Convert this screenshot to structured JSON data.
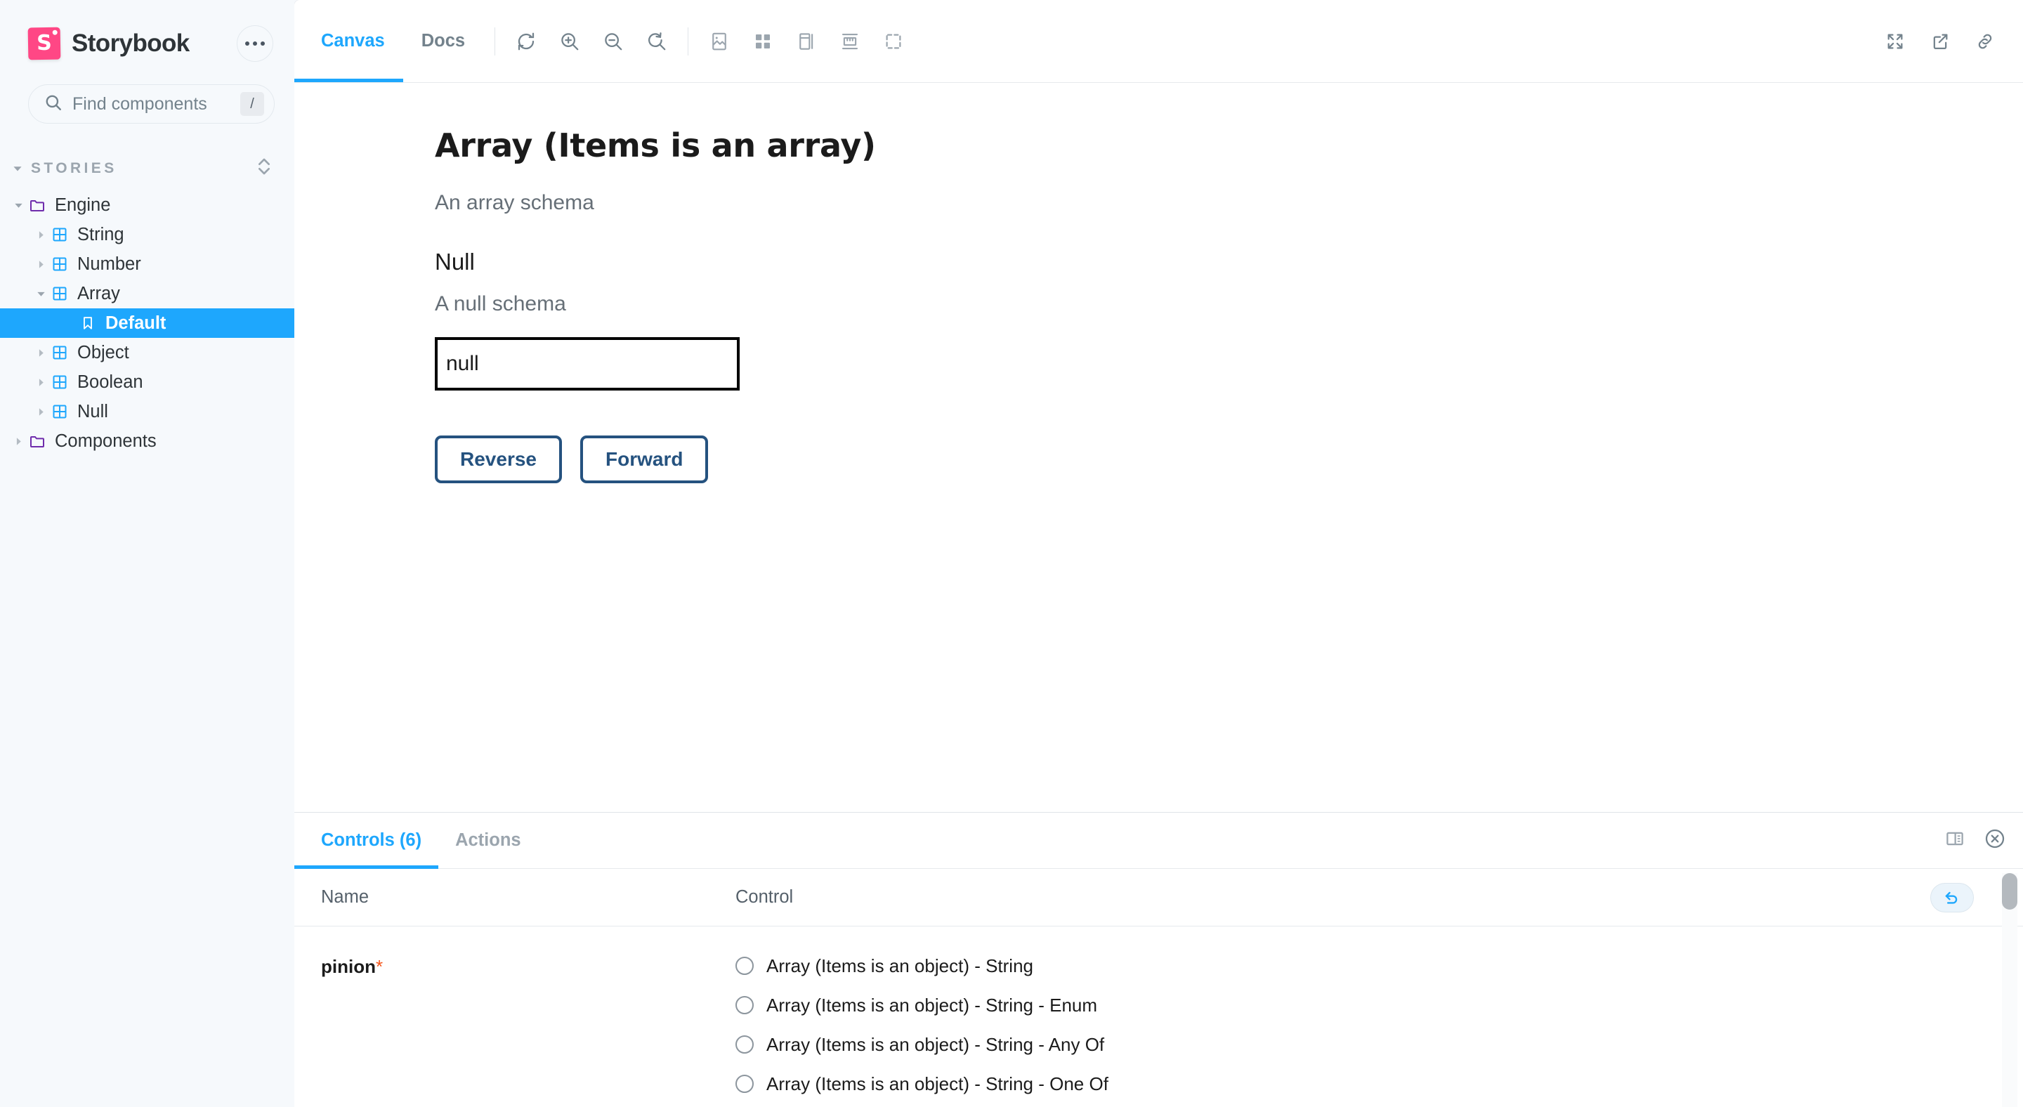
{
  "sidebar": {
    "brand": {
      "name": "Storybook",
      "logo_glyph": "S",
      "logo_color": "#FF4785"
    },
    "menu_button": "menu-dots",
    "search": {
      "placeholder": "Find components",
      "shortcut": "/"
    },
    "section": {
      "label": "STORIES"
    },
    "tree": [
      {
        "label": "Engine",
        "depth": 0,
        "icon": "folder",
        "caret": "down",
        "selected": false
      },
      {
        "label": "String",
        "depth": 1,
        "icon": "component",
        "caret": "right",
        "selected": false
      },
      {
        "label": "Number",
        "depth": 1,
        "icon": "component",
        "caret": "right",
        "selected": false
      },
      {
        "label": "Array",
        "depth": 1,
        "icon": "component",
        "caret": "down",
        "selected": false
      },
      {
        "label": "Default",
        "depth": 2,
        "icon": "bookmark",
        "caret": "none",
        "selected": true
      },
      {
        "label": "Object",
        "depth": 1,
        "icon": "component",
        "caret": "right",
        "selected": false
      },
      {
        "label": "Boolean",
        "depth": 1,
        "icon": "component",
        "caret": "right",
        "selected": false
      },
      {
        "label": "Null",
        "depth": 1,
        "icon": "component",
        "caret": "right",
        "selected": false
      },
      {
        "label": "Components",
        "depth": 0,
        "icon": "folder",
        "caret": "right",
        "selected": false
      }
    ]
  },
  "toolbar": {
    "tabs": [
      {
        "label": "Canvas",
        "active": true
      },
      {
        "label": "Docs",
        "active": false
      }
    ],
    "tools": [
      "refresh-icon",
      "zoom-in-icon",
      "zoom-out-icon",
      "zoom-reset-icon",
      "backgrounds-icon",
      "grid-icon",
      "outline-icon",
      "measure-icon",
      "viewport-icon"
    ],
    "right_tools": [
      "fullscreen-icon",
      "open-new-tab-icon",
      "copy-link-icon"
    ]
  },
  "story": {
    "title": "Array (Items is an array)",
    "description": "An array schema",
    "subtitle": "Null",
    "sub_description": "A null schema",
    "input_value": "null",
    "buttons": [
      {
        "label": "Reverse"
      },
      {
        "label": "Forward"
      }
    ],
    "button_color": "#25527F"
  },
  "panel": {
    "tabs": [
      {
        "label": "Controls (6)",
        "active": true
      },
      {
        "label": "Actions",
        "active": false
      }
    ],
    "right_tools": [
      "panel-position-icon",
      "close-panel-icon"
    ],
    "table": {
      "headers": {
        "name": "Name",
        "control": "Control"
      },
      "reset_button": "reset-controls-icon",
      "rows": [
        {
          "name": "pinion",
          "required": "*",
          "options": [
            {
              "label": "Array (Items is an object) - String",
              "checked": false
            },
            {
              "label": "Array (Items is an object) - String - Enum",
              "checked": false
            },
            {
              "label": "Array (Items is an object) - String - Any Of",
              "checked": false
            },
            {
              "label": "Array (Items is an object) - String - One Of",
              "checked": false
            }
          ]
        }
      ]
    }
  },
  "colors": {
    "accent": "#1EA7FD",
    "brand_pink": "#FF4785",
    "required_orange": "#F4541A",
    "sidebar_bg": "#F6F9FC"
  }
}
